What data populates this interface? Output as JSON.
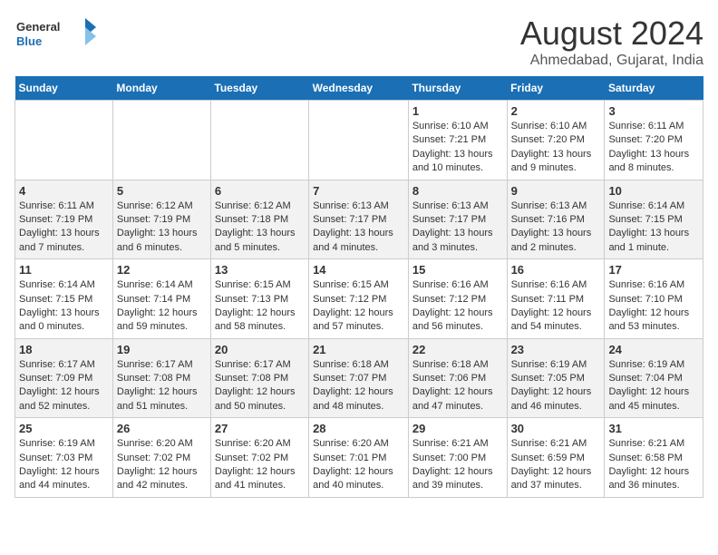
{
  "logo": {
    "line1": "General",
    "line2": "Blue"
  },
  "title": "August 2024",
  "subtitle": "Ahmedabad, Gujarat, India",
  "days_of_week": [
    "Sunday",
    "Monday",
    "Tuesday",
    "Wednesday",
    "Thursday",
    "Friday",
    "Saturday"
  ],
  "weeks": [
    [
      {
        "day": "",
        "info": ""
      },
      {
        "day": "",
        "info": ""
      },
      {
        "day": "",
        "info": ""
      },
      {
        "day": "",
        "info": ""
      },
      {
        "day": "1",
        "info": "Sunrise: 6:10 AM\nSunset: 7:21 PM\nDaylight: 13 hours\nand 10 minutes."
      },
      {
        "day": "2",
        "info": "Sunrise: 6:10 AM\nSunset: 7:20 PM\nDaylight: 13 hours\nand 9 minutes."
      },
      {
        "day": "3",
        "info": "Sunrise: 6:11 AM\nSunset: 7:20 PM\nDaylight: 13 hours\nand 8 minutes."
      }
    ],
    [
      {
        "day": "4",
        "info": "Sunrise: 6:11 AM\nSunset: 7:19 PM\nDaylight: 13 hours\nand 7 minutes."
      },
      {
        "day": "5",
        "info": "Sunrise: 6:12 AM\nSunset: 7:19 PM\nDaylight: 13 hours\nand 6 minutes."
      },
      {
        "day": "6",
        "info": "Sunrise: 6:12 AM\nSunset: 7:18 PM\nDaylight: 13 hours\nand 5 minutes."
      },
      {
        "day": "7",
        "info": "Sunrise: 6:13 AM\nSunset: 7:17 PM\nDaylight: 13 hours\nand 4 minutes."
      },
      {
        "day": "8",
        "info": "Sunrise: 6:13 AM\nSunset: 7:17 PM\nDaylight: 13 hours\nand 3 minutes."
      },
      {
        "day": "9",
        "info": "Sunrise: 6:13 AM\nSunset: 7:16 PM\nDaylight: 13 hours\nand 2 minutes."
      },
      {
        "day": "10",
        "info": "Sunrise: 6:14 AM\nSunset: 7:15 PM\nDaylight: 13 hours\nand 1 minute."
      }
    ],
    [
      {
        "day": "11",
        "info": "Sunrise: 6:14 AM\nSunset: 7:15 PM\nDaylight: 13 hours\nand 0 minutes."
      },
      {
        "day": "12",
        "info": "Sunrise: 6:14 AM\nSunset: 7:14 PM\nDaylight: 12 hours\nand 59 minutes."
      },
      {
        "day": "13",
        "info": "Sunrise: 6:15 AM\nSunset: 7:13 PM\nDaylight: 12 hours\nand 58 minutes."
      },
      {
        "day": "14",
        "info": "Sunrise: 6:15 AM\nSunset: 7:12 PM\nDaylight: 12 hours\nand 57 minutes."
      },
      {
        "day": "15",
        "info": "Sunrise: 6:16 AM\nSunset: 7:12 PM\nDaylight: 12 hours\nand 56 minutes."
      },
      {
        "day": "16",
        "info": "Sunrise: 6:16 AM\nSunset: 7:11 PM\nDaylight: 12 hours\nand 54 minutes."
      },
      {
        "day": "17",
        "info": "Sunrise: 6:16 AM\nSunset: 7:10 PM\nDaylight: 12 hours\nand 53 minutes."
      }
    ],
    [
      {
        "day": "18",
        "info": "Sunrise: 6:17 AM\nSunset: 7:09 PM\nDaylight: 12 hours\nand 52 minutes."
      },
      {
        "day": "19",
        "info": "Sunrise: 6:17 AM\nSunset: 7:08 PM\nDaylight: 12 hours\nand 51 minutes."
      },
      {
        "day": "20",
        "info": "Sunrise: 6:17 AM\nSunset: 7:08 PM\nDaylight: 12 hours\nand 50 minutes."
      },
      {
        "day": "21",
        "info": "Sunrise: 6:18 AM\nSunset: 7:07 PM\nDaylight: 12 hours\nand 48 minutes."
      },
      {
        "day": "22",
        "info": "Sunrise: 6:18 AM\nSunset: 7:06 PM\nDaylight: 12 hours\nand 47 minutes."
      },
      {
        "day": "23",
        "info": "Sunrise: 6:19 AM\nSunset: 7:05 PM\nDaylight: 12 hours\nand 46 minutes."
      },
      {
        "day": "24",
        "info": "Sunrise: 6:19 AM\nSunset: 7:04 PM\nDaylight: 12 hours\nand 45 minutes."
      }
    ],
    [
      {
        "day": "25",
        "info": "Sunrise: 6:19 AM\nSunset: 7:03 PM\nDaylight: 12 hours\nand 44 minutes."
      },
      {
        "day": "26",
        "info": "Sunrise: 6:20 AM\nSunset: 7:02 PM\nDaylight: 12 hours\nand 42 minutes."
      },
      {
        "day": "27",
        "info": "Sunrise: 6:20 AM\nSunset: 7:02 PM\nDaylight: 12 hours\nand 41 minutes."
      },
      {
        "day": "28",
        "info": "Sunrise: 6:20 AM\nSunset: 7:01 PM\nDaylight: 12 hours\nand 40 minutes."
      },
      {
        "day": "29",
        "info": "Sunrise: 6:21 AM\nSunset: 7:00 PM\nDaylight: 12 hours\nand 39 minutes."
      },
      {
        "day": "30",
        "info": "Sunrise: 6:21 AM\nSunset: 6:59 PM\nDaylight: 12 hours\nand 37 minutes."
      },
      {
        "day": "31",
        "info": "Sunrise: 6:21 AM\nSunset: 6:58 PM\nDaylight: 12 hours\nand 36 minutes."
      }
    ]
  ]
}
